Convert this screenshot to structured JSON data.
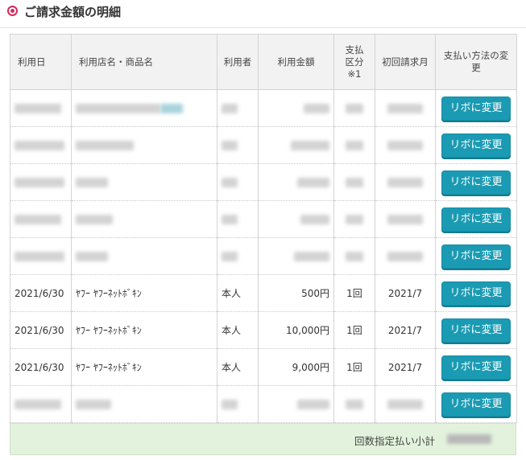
{
  "page": {
    "title": "ご請求金額の明細"
  },
  "table": {
    "headers": {
      "date": "利用日",
      "store": "利用店名・商品名",
      "user": "利用者",
      "amount": "利用金額",
      "payment_type": "支払区分※1",
      "first_billing": "初回請求月",
      "change_method": "支払い方法の変更"
    },
    "button_label": "リボに変更",
    "visible_rows": [
      {
        "date": "2021/6/30",
        "store": "ﾔﾌｰ ﾔﾌｰﾈｯﾄﾎﾞｷﾝ",
        "user": "本人",
        "amount": "500円",
        "payment_type": "1回",
        "first_billing": "2021/7"
      },
      {
        "date": "2021/6/30",
        "store": "ﾔﾌｰ ﾔﾌｰﾈｯﾄﾎﾞｷﾝ",
        "user": "本人",
        "amount": "10,000円",
        "payment_type": "1回",
        "first_billing": "2021/7"
      },
      {
        "date": "2021/6/30",
        "store": "ﾔﾌｰ ﾔﾌｰﾈｯﾄﾎﾞｷﾝ",
        "user": "本人",
        "amount": "9,000円",
        "payment_type": "1回",
        "first_billing": "2021/7"
      }
    ]
  },
  "subtotal": {
    "label": "回数指定払い小計"
  }
}
